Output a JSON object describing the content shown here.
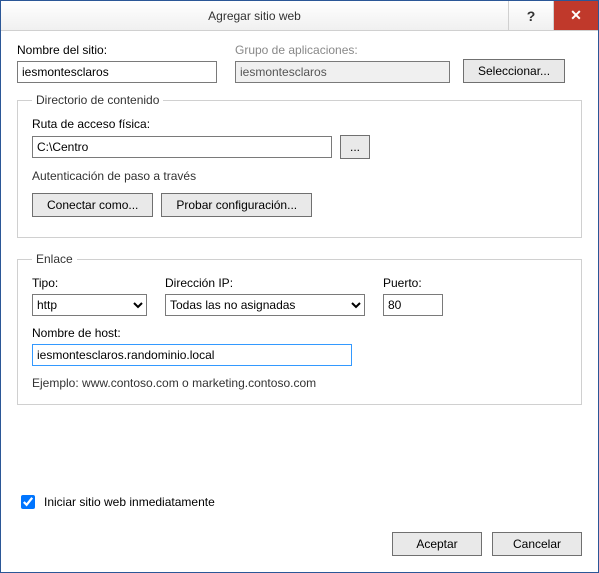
{
  "titlebar": {
    "title": "Agregar sitio web"
  },
  "labels": {
    "siteName": "Nombre del sitio:",
    "appPool": "Grupo de aplicaciones:",
    "select": "Seleccionar...",
    "contentDir": "Directorio de contenido",
    "physicalPath": "Ruta de acceso física:",
    "browse": "...",
    "passthrough": "Autenticación de paso a través",
    "connectAs": "Conectar como...",
    "testSettings": "Probar configuración...",
    "binding": "Enlace",
    "type": "Tipo:",
    "ip": "Dirección IP:",
    "port": "Puerto:",
    "hostname": "Nombre de host:",
    "example": "Ejemplo: www.contoso.com o marketing.contoso.com",
    "startNow": "Iniciar sitio web inmediatamente",
    "ok": "Aceptar",
    "cancel": "Cancelar"
  },
  "values": {
    "siteName": "iesmontesclaros",
    "appPool": "iesmontesclaros",
    "physicalPath": "C:\\Centro",
    "type": "http",
    "ip": "Todas las no asignadas",
    "port": "80",
    "hostname": "iesmontesclaros.randominio.local"
  }
}
